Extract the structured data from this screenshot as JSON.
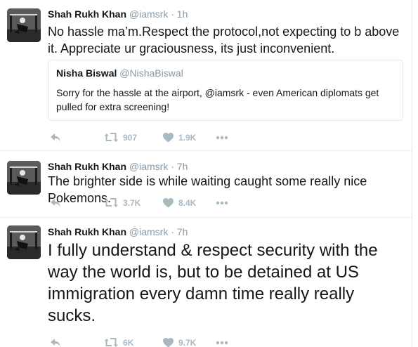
{
  "tweets": [
    {
      "fullname": "Shah Rukh Khan",
      "screenname": "@iamsrk",
      "separator": "·",
      "time": "1h",
      "text": "No hassle ma’m.Respect the protocol,not expecting to b above it. Appreciate ur graciousness, its just inconvenient.",
      "quote": {
        "fullname": "Nisha Biswal",
        "screenname": "@NishaBiswal",
        "text": "Sorry for the hassle at the airport, @iamsrk - even American diplomats get pulled for extra screening!"
      },
      "retweets": "907",
      "likes": "1.9K"
    },
    {
      "fullname": "Shah Rukh Khan",
      "screenname": "@iamsrk",
      "separator": "·",
      "time": "7h",
      "text": "The brighter side is while waiting caught some really nice Pokemons.",
      "retweets": "3.7K",
      "likes": "8.4K"
    },
    {
      "fullname": "Shah Rukh Khan",
      "screenname": "@iamsrk",
      "separator": "·",
      "time": "7h",
      "text": "I fully understand & respect security with the way the world is, but to be detained at US immigration every damn time really really sucks.",
      "retweets": "6K",
      "likes": "9.7K"
    }
  ],
  "icons": {
    "reply": "reply-icon",
    "retweet": "retweet-icon",
    "like": "heart-icon",
    "more": "more-dots-icon"
  },
  "colors": {
    "text": "#14171a",
    "secondary": "#8899a6",
    "action": "#aab8c2",
    "border": "#e6ecf0"
  }
}
